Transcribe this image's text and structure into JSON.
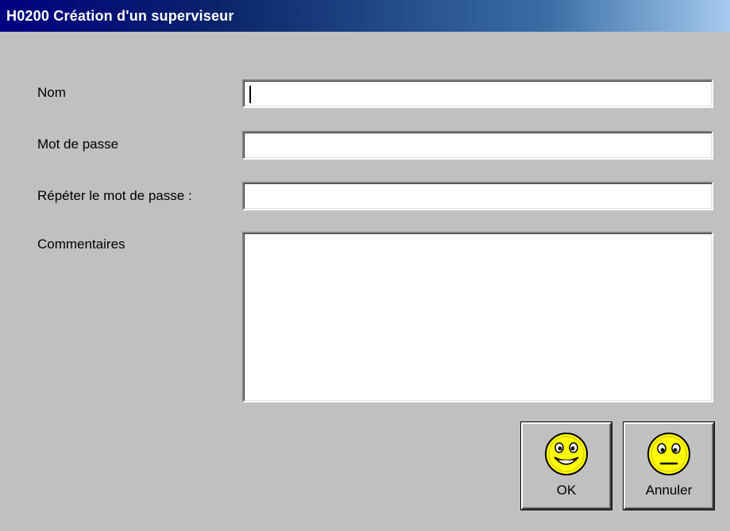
{
  "window": {
    "title": "H0200 Création d'un superviseur"
  },
  "form": {
    "nom_label": "Nom",
    "nom_value": "",
    "mot_de_passe_label": "Mot de passe",
    "mot_de_passe_value": "",
    "repeter_label": "Répéter le mot de passe :",
    "repeter_value": "",
    "commentaires_label": "Commentaires",
    "commentaires_value": ""
  },
  "buttons": {
    "ok_label": "OK",
    "ok_icon": "happy-smiley-icon",
    "annuler_label": "Annuler",
    "annuler_icon": "neutral-smiley-icon"
  },
  "colors": {
    "title_bar_start": "#000080",
    "title_bar_end": "#a6caf0",
    "face": "#c0c0c0",
    "smiley": "#ffff00"
  }
}
